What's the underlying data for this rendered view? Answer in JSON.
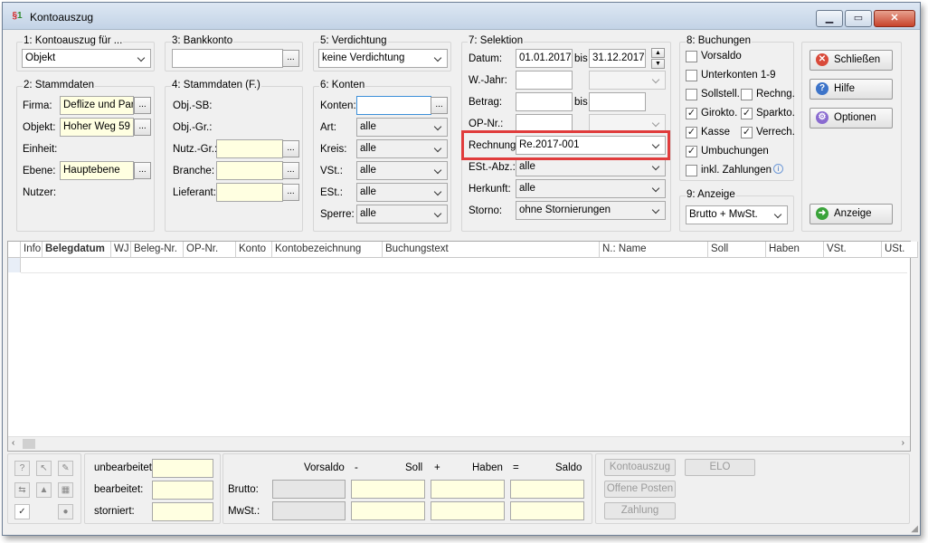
{
  "window": {
    "title": "Kontoauszug"
  },
  "g1": {
    "label": "1: Kontoauszug für ...",
    "value": "Objekt"
  },
  "g2": {
    "label": "2: Stammdaten",
    "firma_label": "Firma:",
    "firma_value": "Deflize und Part",
    "objekt_label": "Objekt:",
    "objekt_value": "Hoher Weg 59 ·",
    "einheit_label": "Einheit:",
    "ebene_label": "Ebene:",
    "ebene_value": "Hauptebene",
    "nutzer_label": "Nutzer:"
  },
  "g3": {
    "label": "3: Bankkonto",
    "value": ""
  },
  "g4": {
    "label": "4: Stammdaten (F.)",
    "objsb_label": "Obj.-SB:",
    "objgr_label": "Obj.-Gr.:",
    "nutzgr_label": "Nutz.-Gr.:",
    "branche_label": "Branche:",
    "lieferant_label": "Lieferant:"
  },
  "g5": {
    "label": "5: Verdichtung",
    "value": "keine Verdichtung"
  },
  "g6": {
    "label": "6: Konten",
    "konten_label": "Konten:",
    "art_label": "Art:",
    "art_value": "alle",
    "kreis_label": "Kreis:",
    "kreis_value": "alle",
    "vst_label": "VSt.:",
    "vst_value": "alle",
    "est_label": "ESt.:",
    "est_value": "alle",
    "sperre_label": "Sperre:",
    "sperre_value": "alle"
  },
  "g7": {
    "label": "7: Selektion",
    "datum_label": "Datum:",
    "datum_from": "01.01.2017",
    "bis1": "bis",
    "datum_to": "31.12.2017",
    "wjahr_label": "W.-Jahr:",
    "betrag_label": "Betrag:",
    "bis2": "bis",
    "opnr_label": "OP-Nr.:",
    "rechnung_label": "Rechnung",
    "rechnung_value": "Re.2017-001",
    "estabz_label": "ESt.-Abz.:",
    "estabz_value": "alle",
    "herkunft_label": "Herkunft:",
    "herkunft_value": "alle",
    "storno_label": "Storno:",
    "storno_value": "ohne Stornierungen"
  },
  "g8": {
    "label": "8: Buchungen",
    "vorsaldo": "Vorsaldo",
    "unterkonten": "Unterkonten 1-9",
    "sollstell": "Sollstell.",
    "rechng": "Rechng.",
    "girokto": "Girokto.",
    "sparkto": "Sparkto.",
    "kasse": "Kasse",
    "verrech": "Verrech.",
    "umbuchungen": "Umbuchungen",
    "inkl_zahlungen": "inkl. Zahlungen"
  },
  "g9": {
    "label": "9: Anzeige",
    "value": "Brutto + MwSt."
  },
  "buttons": {
    "schliessen": "Schließen",
    "hilfe": "Hilfe",
    "optionen": "Optionen",
    "anzeige": "Anzeige"
  },
  "table": {
    "columns": [
      "Info",
      "Belegdatum",
      "WJ",
      "Beleg-Nr.",
      "OP-Nr.",
      "Konto",
      "Kontobezeichnung",
      "Buchungstext",
      "N.: Name",
      "Soll",
      "Haben",
      "VSt.",
      "USt."
    ]
  },
  "footer": {
    "unbearbeitet": "unbearbeitet:",
    "bearbeitet": "bearbeitet:",
    "storniert": "storniert:",
    "vorsaldo": "Vorsaldo",
    "minus": "-",
    "soll": "Soll",
    "plus": "+",
    "haben": "Haben",
    "equals": "=",
    "saldo": "Saldo",
    "brutto": "Brutto:",
    "mwst": "MwSt.:",
    "btn_kontoauszug": "Kontoauszug",
    "btn_elo": "ELO",
    "btn_offene_posten": "Offene Posten",
    "btn_zahlung": "Zahlung"
  }
}
